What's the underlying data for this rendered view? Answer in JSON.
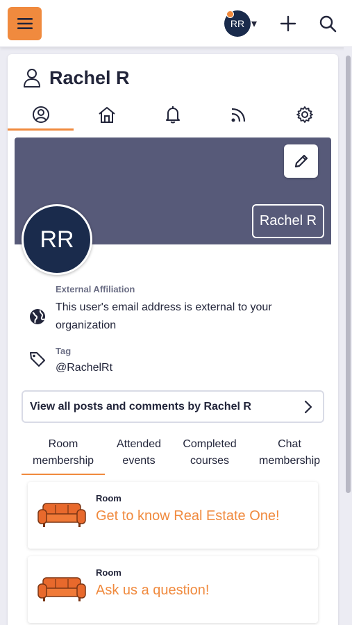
{
  "topbar": {
    "menu_icon": "hamburger-icon",
    "avatar_initials": "RR",
    "caret": "▾",
    "plus_icon": "plus-icon",
    "search_icon": "search-icon",
    "accent": "#f08a3e"
  },
  "profile": {
    "name": "Rachel R",
    "initials": "RR",
    "banner_color": "#575a79",
    "avatar_color": "#1a2b4c"
  },
  "tabs": [
    {
      "icon": "user-circle-icon",
      "active": true
    },
    {
      "icon": "home-icon",
      "active": false
    },
    {
      "icon": "bell-icon",
      "active": false
    },
    {
      "icon": "feed-icon",
      "active": false
    },
    {
      "icon": "gear-icon",
      "active": false
    }
  ],
  "fields": {
    "affiliation_label": "External Affiliation",
    "affiliation_value": "This user's email address is external to your organization",
    "tag_label": "Tag",
    "tag_value": "@RachelRt"
  },
  "posts_button": "View all posts and comments by Rachel R",
  "subtabs": [
    {
      "line1": "Room",
      "line2": "membership",
      "active": true
    },
    {
      "line1": "Attended",
      "line2": "events",
      "active": false
    },
    {
      "line1": "Completed",
      "line2": "courses",
      "active": false
    },
    {
      "line1": "Chat",
      "line2": "membership",
      "active": false
    }
  ],
  "rooms": [
    {
      "kind": "Room",
      "name": "Get to know Real Estate One!"
    },
    {
      "kind": "Room",
      "name": "Ask us a question!"
    }
  ]
}
